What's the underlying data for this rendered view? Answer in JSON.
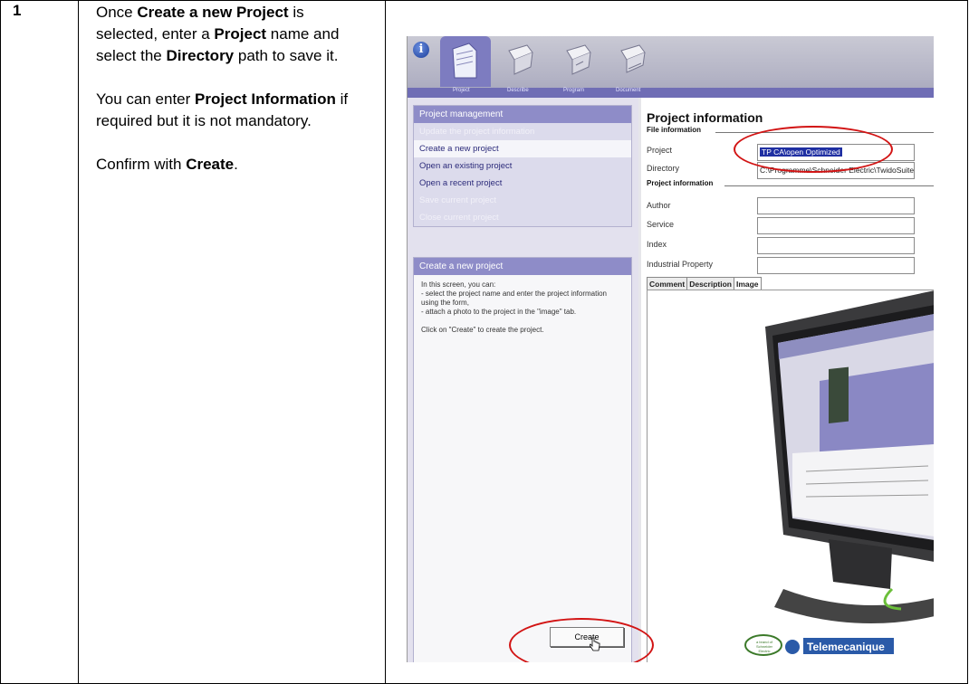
{
  "step": {
    "number": "1",
    "paragraphs": [
      [
        {
          "t": "Once ",
          "b": false
        },
        {
          "t": "Create a new Project",
          "b": true
        },
        {
          "t": " is selected, enter a ",
          "b": false
        },
        {
          "t": "Project",
          "b": true
        },
        {
          "t": " name and select the ",
          "b": false
        },
        {
          "t": "Directory",
          "b": true
        },
        {
          "t": " path to save it.",
          "b": false
        }
      ],
      [
        {
          "t": "You can enter ",
          "b": false
        },
        {
          "t": "Project Information",
          "b": true
        },
        {
          "t": " if required but it is not mandatory.",
          "b": false
        }
      ],
      [
        {
          "t": "Confirm with ",
          "b": false
        },
        {
          "t": "Create",
          "b": true
        },
        {
          "t": ".",
          "b": false
        }
      ]
    ]
  },
  "app": {
    "tabs": [
      "Project",
      "Describe",
      "Program",
      "Document"
    ],
    "project_management": {
      "header": "Project management",
      "items": [
        {
          "label": "Update the project information",
          "state": "disabled"
        },
        {
          "label": "Create a new project",
          "state": "selected"
        },
        {
          "label": "Open an existing project",
          "state": "normal"
        },
        {
          "label": "Open a recent project",
          "state": "normal"
        },
        {
          "label": "Save current project",
          "state": "disabled"
        },
        {
          "label": "Close current project",
          "state": "disabled"
        }
      ]
    },
    "create_new_project": {
      "header": "Create a new project",
      "help_paragraphs": [
        "In this screen, you can:\n - select the project name and enter the project information using the form,\n - attach a photo to the project in the \"image\" tab.",
        "Click on \"Create\" to create the project."
      ]
    },
    "create_button": "Create",
    "project_information": {
      "title": "Project information",
      "file_information_label": "File information",
      "project_label": "Project",
      "project_value": "TP CA\\open Optimized",
      "directory_label": "Directory",
      "directory_value": "C:\\Programme\\Schneider Electric\\TwidoSuite",
      "project_information_label": "Project information",
      "author_label": "Author",
      "service_label": "Service",
      "index_label": "Index",
      "industrial_property_label": "Industrial Property"
    },
    "detail_tabs": [
      "Comment",
      "Description",
      "Image"
    ],
    "active_detail_tab": "Image",
    "image_logos": {
      "schneider": "a brand of Schneider Electric",
      "telemecanique": "Telemecanique"
    },
    "colors": {
      "highlight_circle": "#d21414",
      "tab_active": "#7d7cc0",
      "panel_header": "#8e8cc8"
    }
  }
}
